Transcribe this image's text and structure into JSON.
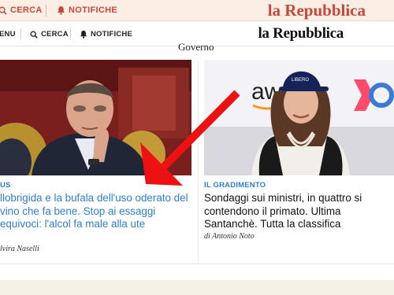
{
  "ghost_toolbar": {
    "search_label": "CERCA",
    "notifications_label": "NOTIFICHE",
    "logo": "la Repubblica"
  },
  "header": {
    "menu_label": "ENU",
    "search_label": "CERCA",
    "notifications_label": "NOTIFICHE",
    "logo": "la Repubblica"
  },
  "section": {
    "label": "Governo"
  },
  "articles": [
    {
      "kicker": "US",
      "title": "llobrigida e la bufala dell'uso oderato del vino che fa bene. Stop ai essaggi equivoci: l'alcol fa male alla ute",
      "author": "lvira Naselli"
    },
    {
      "kicker": "IL GRADIMENTO",
      "title": "Sondaggi sui ministri, in quattro si contendono il primato. Ultima Santanchè. Tutta la classifica",
      "author": "di Antonio Noto",
      "image_banner_text": "aws",
      "image_cap_text": "LIBERO"
    }
  ],
  "colors": {
    "brand_red": "#c8473c",
    "link_blue": "#2e7fd0",
    "annotation_arrow": "#ee1111"
  }
}
